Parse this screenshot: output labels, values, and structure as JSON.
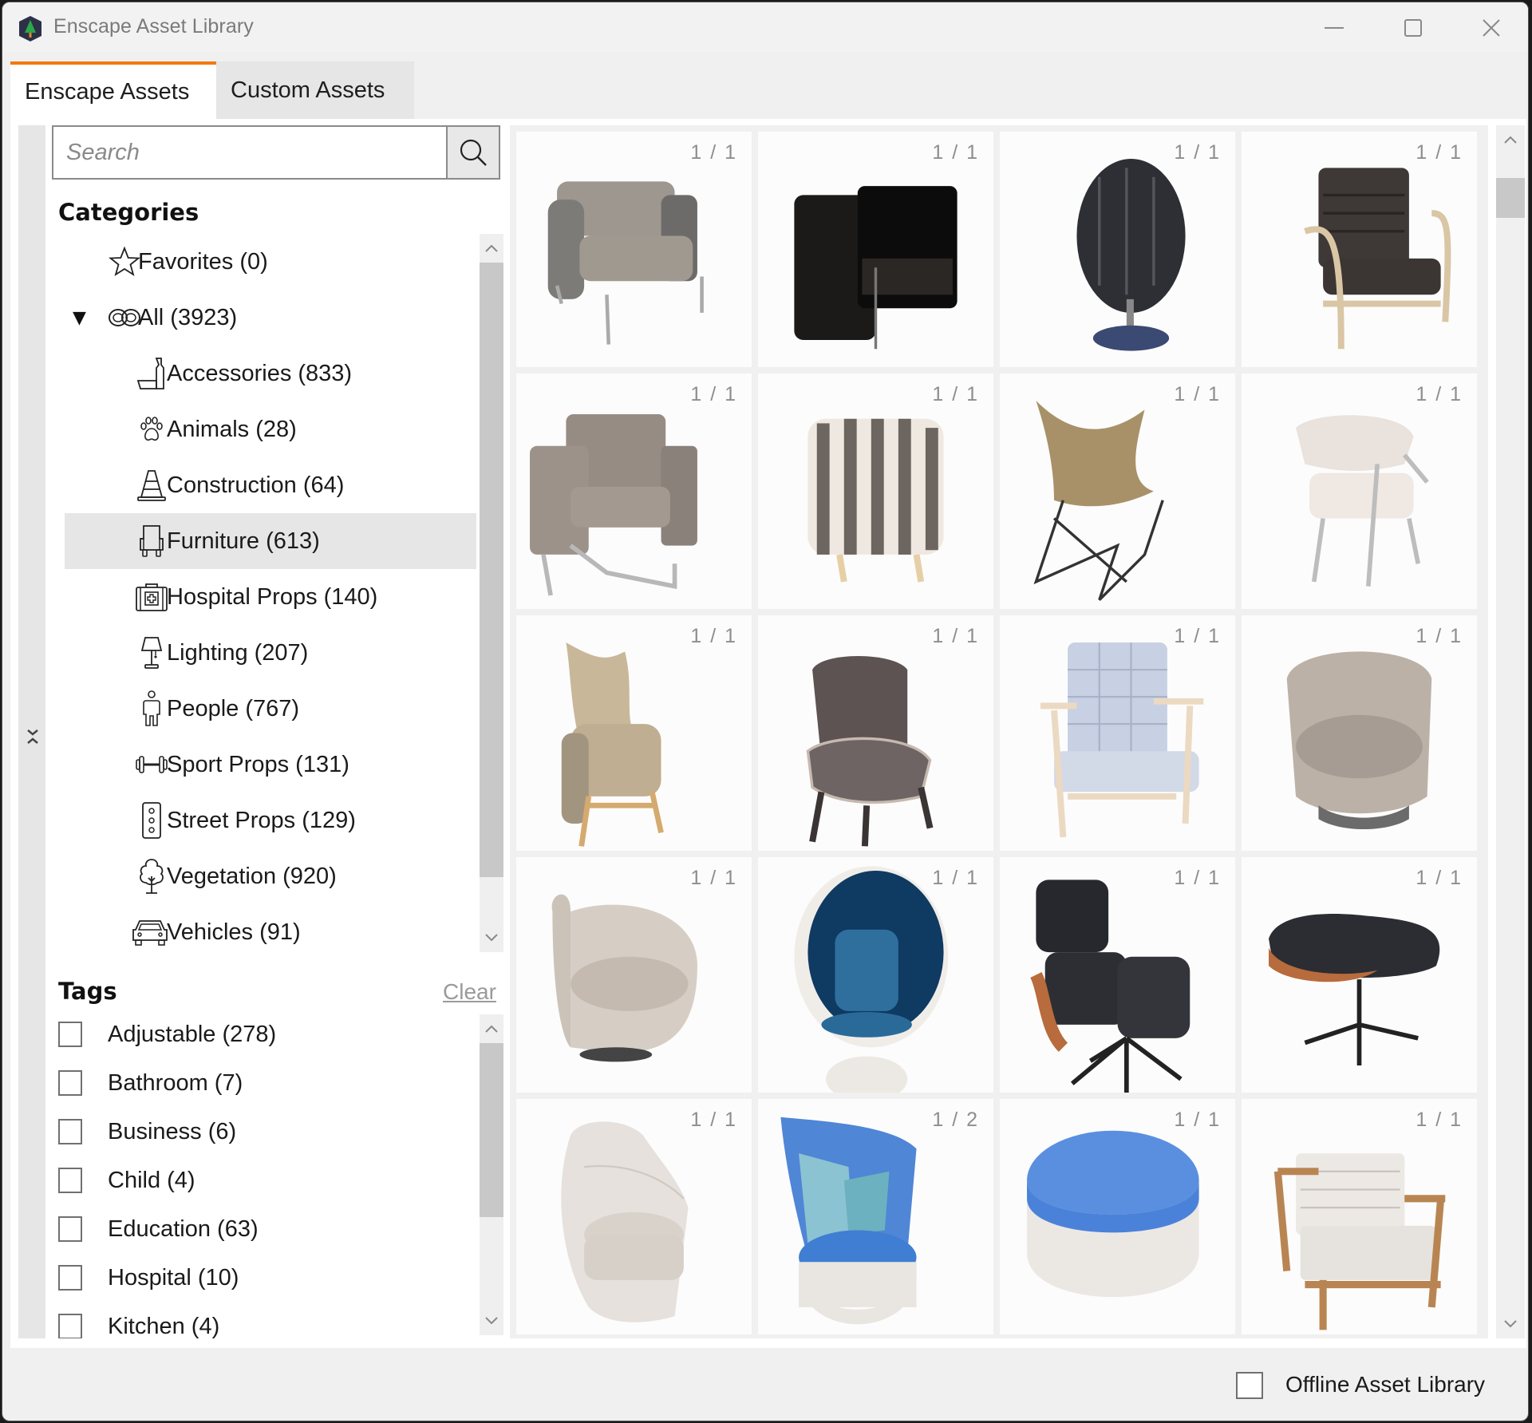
{
  "window": {
    "title": "Enscape Asset Library",
    "app_icon": "enscape-tree-icon",
    "controls": [
      "minimize-icon",
      "maximize-icon",
      "close-icon"
    ]
  },
  "tabs": [
    {
      "label": "Enscape Assets",
      "active": true
    },
    {
      "label": "Custom Assets",
      "active": false
    }
  ],
  "accent_color": "#f07a10",
  "search": {
    "placeholder": "Search",
    "value": "",
    "button_icon": "search-icon"
  },
  "categories": {
    "title": "Categories",
    "items": [
      {
        "label": "Favorites (0)",
        "icon": "star-icon",
        "level": 0
      },
      {
        "label": "All (3923)",
        "icon": "infinity-icon",
        "level": 0,
        "expanded": true
      },
      {
        "label": "Accessories (833)",
        "icon": "accessories-icon",
        "level": 1
      },
      {
        "label": "Animals (28)",
        "icon": "paw-icon",
        "level": 1
      },
      {
        "label": "Construction (64)",
        "icon": "traffic-cone-icon",
        "level": 1
      },
      {
        "label": "Furniture (613)",
        "icon": "chair-icon",
        "level": 1,
        "selected": true
      },
      {
        "label": "Hospital Props (140)",
        "icon": "first-aid-kit-icon",
        "level": 1
      },
      {
        "label": "Lighting (207)",
        "icon": "lamp-icon",
        "level": 1
      },
      {
        "label": "People (767)",
        "icon": "person-icon",
        "level": 1
      },
      {
        "label": "Sport Props (131)",
        "icon": "dumbbell-icon",
        "level": 1
      },
      {
        "label": "Street Props (129)",
        "icon": "traffic-light-icon",
        "level": 1
      },
      {
        "label": "Vegetation (920)",
        "icon": "tree-icon",
        "level": 1
      },
      {
        "label": "Vehicles (91)",
        "icon": "car-icon",
        "level": 1
      }
    ]
  },
  "tags": {
    "title": "Tags",
    "clear_label": "Clear",
    "items": [
      {
        "label": "Adjustable (278)",
        "checked": false
      },
      {
        "label": "Bathroom (7)",
        "checked": false
      },
      {
        "label": "Business (6)",
        "checked": false
      },
      {
        "label": "Child (4)",
        "checked": false
      },
      {
        "label": "Education (63)",
        "checked": false
      },
      {
        "label": "Hospital (10)",
        "checked": false
      },
      {
        "label": "Kitchen (4)",
        "checked": false
      }
    ]
  },
  "assets": [
    {
      "variant": "1 / 1",
      "kind": "armchair-gray-modern"
    },
    {
      "variant": "1 / 1",
      "kind": "armchair-black-leather-cube"
    },
    {
      "variant": "1 / 1",
      "kind": "swivel-chair-black-quilted"
    },
    {
      "variant": "1 / 1",
      "kind": "armchair-dark-wood-frame"
    },
    {
      "variant": "1 / 1",
      "kind": "armchair-taupe-sled-base"
    },
    {
      "variant": "1 / 1",
      "kind": "armchair-striped"
    },
    {
      "variant": "1 / 1",
      "kind": "butterfly-chair-tan"
    },
    {
      "variant": "1 / 1",
      "kind": "chair-white-metal-legs"
    },
    {
      "variant": "1 / 1",
      "kind": "wingback-chair-beige"
    },
    {
      "variant": "1 / 1",
      "kind": "chair-dark-taupe"
    },
    {
      "variant": "1 / 1",
      "kind": "armchair-light-blue-tufted"
    },
    {
      "variant": "1 / 1",
      "kind": "tub-chair-beige"
    },
    {
      "variant": "1 / 1",
      "kind": "swivel-chair-cream"
    },
    {
      "variant": "1 / 1",
      "kind": "egg-ball-chair-blue"
    },
    {
      "variant": "1 / 1",
      "kind": "lounge-chair-black-leather"
    },
    {
      "variant": "1 / 1",
      "kind": "ottoman-black-leather"
    },
    {
      "variant": "1 / 1",
      "kind": "shell-chair-white"
    },
    {
      "variant": "1 / 2",
      "kind": "high-back-chair-blue-pillows"
    },
    {
      "variant": "1 / 1",
      "kind": "pouf-blue-white"
    },
    {
      "variant": "1 / 1",
      "kind": "armchair-wood-patterned"
    }
  ],
  "footer": {
    "offline_label": "Offline Asset Library",
    "offline_checked": false
  }
}
